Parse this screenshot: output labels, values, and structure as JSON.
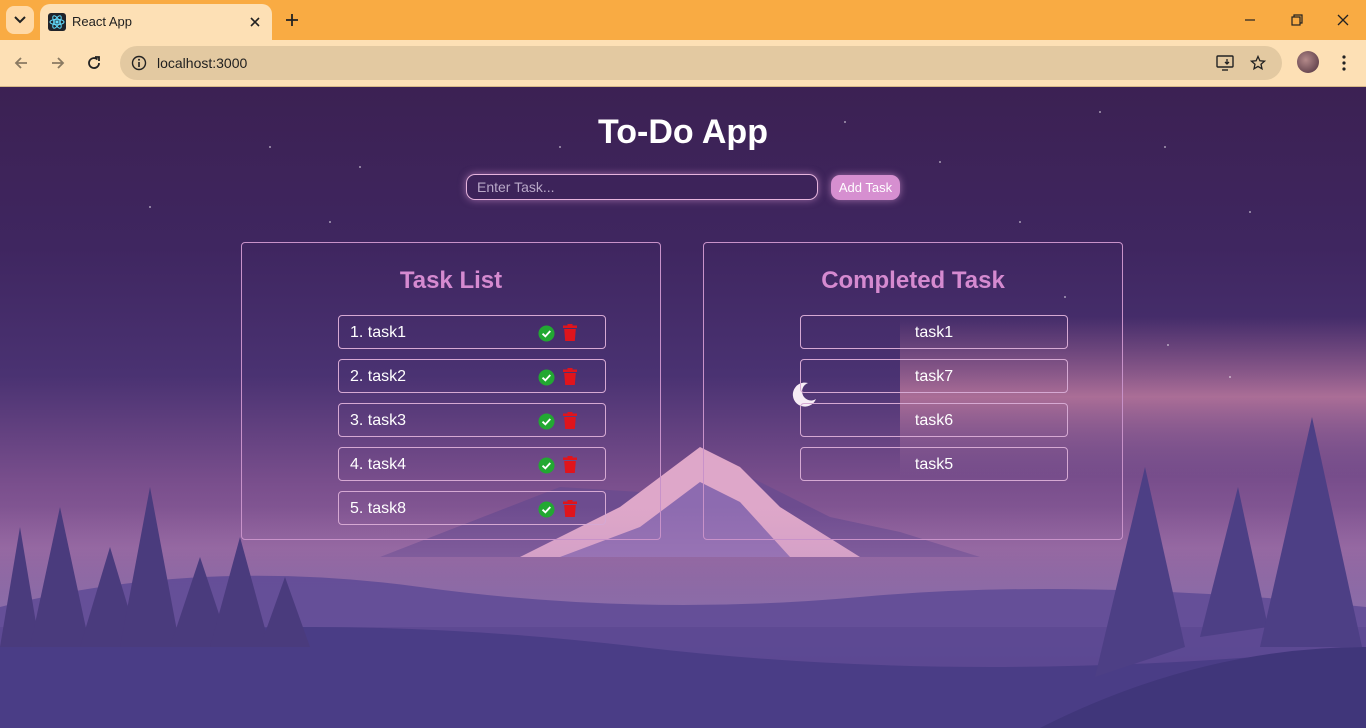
{
  "browser": {
    "tab_title": "React App",
    "url": "localhost:3000",
    "colors": {
      "frame": "#f9ab43",
      "toolbar": "#fde0b5",
      "omnibox": "#e3c9a1"
    }
  },
  "app": {
    "title": "To-Do App",
    "input": {
      "placeholder": "Enter Task...",
      "value": ""
    },
    "add_button_label": "Add Task",
    "task_list": {
      "title": "Task List",
      "items": [
        {
          "label": "1. task1"
        },
        {
          "label": "2. task2"
        },
        {
          "label": "3. task3"
        },
        {
          "label": "4. task4"
        },
        {
          "label": "5. task8"
        }
      ]
    },
    "completed": {
      "title": "Completed Task",
      "items": [
        {
          "label": "task1"
        },
        {
          "label": "task7"
        },
        {
          "label": "task6"
        },
        {
          "label": "task5"
        }
      ]
    },
    "colors": {
      "accent": "#d58ad0",
      "add_button": "#d68fd0",
      "complete_icon": "#22a832",
      "delete_icon": "#e0141c"
    },
    "icons": {
      "complete": "check-circle-icon",
      "delete": "trash-icon"
    }
  }
}
